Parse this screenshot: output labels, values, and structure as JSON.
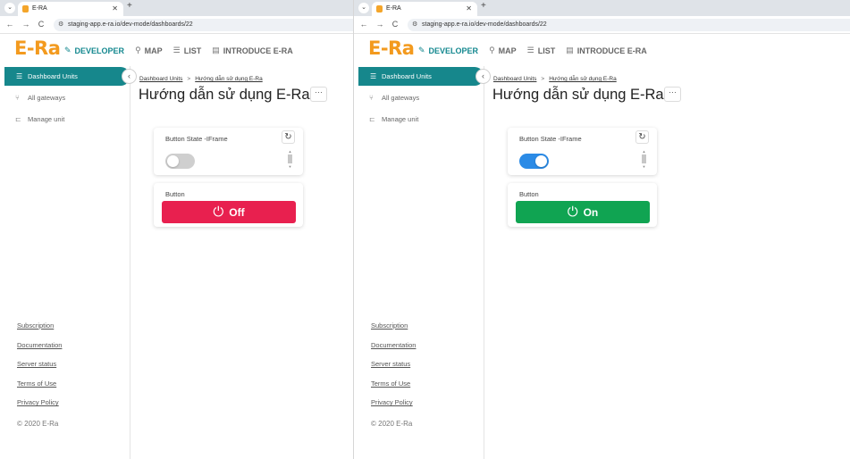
{
  "panes": [
    {
      "browser": {
        "tab_dropdown": "⌄",
        "tab_title": "E-RA",
        "tab_close": "✕",
        "new_tab": "+",
        "back": "←",
        "forward": "→",
        "reload": "C",
        "url": "staging-app.e-ra.io/dev-mode/dashboards/22"
      },
      "header": {
        "logo": "E-Ra",
        "nav": [
          {
            "label": "DEVELOPER",
            "icon": "pencil-icon",
            "glyph": "✎",
            "active": true
          },
          {
            "label": "MAP",
            "icon": "map-pin-icon",
            "glyph": "⚲",
            "active": false
          },
          {
            "label": "LIST",
            "icon": "list-icon",
            "glyph": "☰",
            "active": false
          },
          {
            "label": "INTRODUCE E-RA",
            "icon": "document-icon",
            "glyph": "▤",
            "active": false
          }
        ]
      },
      "sidebar": {
        "items": [
          {
            "label": "Dashboard Units",
            "icon": "dashboard-icon",
            "glyph": "☰"
          },
          {
            "label": "All gateways",
            "icon": "gateway-icon",
            "glyph": "⑂"
          },
          {
            "label": "Manage unit",
            "icon": "unit-icon",
            "glyph": "⊏"
          }
        ],
        "collapse": "‹",
        "footer_links": [
          "Subscription",
          "Documentation",
          "Server status",
          "Terms of Use",
          "Privacy Policy"
        ],
        "copyright": "© 2020 E-Ra"
      },
      "main": {
        "breadcrumb": [
          "Dashboard Units",
          "Hướng dẫn sử dụng E-Ra"
        ],
        "breadcrumb_sep": ">",
        "title": "Hướng dẫn sử dụng E-Ra",
        "more": "···",
        "state_card": {
          "title": "Button State -IFrame",
          "refresh": "↻",
          "toggle_on": false
        },
        "button_card": {
          "title": "Button",
          "label": "Off",
          "power_icon": "⏻",
          "state": "off",
          "color": "#e8204f"
        }
      }
    },
    {
      "browser": {
        "tab_dropdown": "⌄",
        "tab_title": "E-RA",
        "tab_close": "✕",
        "new_tab": "+",
        "back": "←",
        "forward": "→",
        "reload": "C",
        "url": "staging-app.e-ra.io/dev-mode/dashboards/22"
      },
      "header": {
        "logo": "E-Ra",
        "nav": [
          {
            "label": "DEVELOPER",
            "icon": "pencil-icon",
            "glyph": "✎",
            "active": true
          },
          {
            "label": "MAP",
            "icon": "map-pin-icon",
            "glyph": "⚲",
            "active": false
          },
          {
            "label": "LIST",
            "icon": "list-icon",
            "glyph": "☰",
            "active": false
          },
          {
            "label": "INTRODUCE E-RA",
            "icon": "document-icon",
            "glyph": "▤",
            "active": false
          }
        ]
      },
      "sidebar": {
        "items": [
          {
            "label": "Dashboard Units",
            "icon": "dashboard-icon",
            "glyph": "☰"
          },
          {
            "label": "All gateways",
            "icon": "gateway-icon",
            "glyph": "⑂"
          },
          {
            "label": "Manage unit",
            "icon": "unit-icon",
            "glyph": "⊏"
          }
        ],
        "collapse": "‹",
        "footer_links": [
          "Subscription",
          "Documentation",
          "Server status",
          "Terms of Use",
          "Privacy Policy"
        ],
        "copyright": "© 2020 E-Ra"
      },
      "main": {
        "breadcrumb": [
          "Dashboard Units",
          "Hướng dẫn sử dụng E-Ra"
        ],
        "breadcrumb_sep": ">",
        "title": "Hướng dẫn sử dụng E-Ra",
        "more": "···",
        "state_card": {
          "title": "Button State -IFrame",
          "refresh": "↻",
          "toggle_on": true
        },
        "button_card": {
          "title": "Button",
          "label": "On",
          "power_icon": "⏻",
          "state": "on",
          "color": "#10a452"
        }
      }
    }
  ],
  "colors": {
    "accent": "#16878c",
    "logo": "#f39a1e",
    "toggle_on": "#2b8be6",
    "button_off": "#e8204f",
    "button_on": "#10a452"
  }
}
